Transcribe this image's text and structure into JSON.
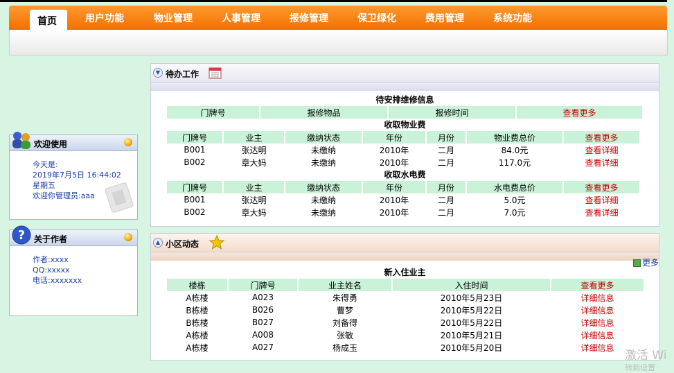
{
  "nav": {
    "active": "首页",
    "items": [
      "用户功能",
      "物业管理",
      "人事管理",
      "报修管理",
      "保卫绿化",
      "费用管理",
      "系统功能"
    ]
  },
  "welcome": {
    "title": "欢迎使用",
    "today_label": "今天是:",
    "datetime": "2019年7月5日  16:44:02",
    "weekday": "星期五",
    "greeting": "欢迎你管理员:aaa"
  },
  "about": {
    "title": "关于作者",
    "author": "作者:xxxx",
    "qq": "QQ:xxxxx",
    "phone": "电话:xxxxxxx"
  },
  "todo": {
    "title": "待办工作",
    "repair": {
      "title": "待安排维修信息",
      "headers": [
        "门牌号",
        "报修物品",
        "报修时间"
      ],
      "more": "查看更多"
    },
    "property_fee": {
      "title": "收取物业费",
      "headers": [
        "门牌号",
        "业主",
        "缴纳状态",
        "年份",
        "月份",
        "物业费总价"
      ],
      "more": "查看更多",
      "detail": "查看详细",
      "rows": [
        [
          "B001",
          "张达明",
          "未缴纳",
          "2010年",
          "二月",
          "84.0元"
        ],
        [
          "B002",
          "章大妈",
          "未缴纳",
          "2010年",
          "二月",
          "117.0元"
        ]
      ]
    },
    "utility_fee": {
      "title": "收取水电费",
      "headers": [
        "门牌号",
        "业主",
        "缴纳状态",
        "年份",
        "月份",
        "水电费总价"
      ],
      "more": "查看更多",
      "detail": "查看详细",
      "rows": [
        [
          "B001",
          "张达明",
          "未缴纳",
          "2010年",
          "二月",
          "5.0元"
        ],
        [
          "B002",
          "章大妈",
          "未缴纳",
          "2010年",
          "二月",
          "7.0元"
        ]
      ]
    }
  },
  "community": {
    "title": "小区动态",
    "more_link": "更多",
    "new_owners": {
      "title": "新入住业主",
      "headers": [
        "楼栋",
        "门牌号",
        "业主姓名",
        "入住时间"
      ],
      "more": "查看更多",
      "detail": "详细信息",
      "rows": [
        [
          "A栋楼",
          "A023",
          "朱得勇",
          "2010年5月23日"
        ],
        [
          "B栋楼",
          "B026",
          "曹梦",
          "2010年5月22日"
        ],
        [
          "B栋楼",
          "B027",
          "刘备得",
          "2010年5月22日"
        ],
        [
          "A栋楼",
          "A008",
          "张敏",
          "2010年5月21日"
        ],
        [
          "A栋楼",
          "A027",
          "杨成玉",
          "2010年5月20日"
        ]
      ]
    }
  },
  "watermark": {
    "line1": "激活 Wi",
    "line2": "转到设置"
  }
}
